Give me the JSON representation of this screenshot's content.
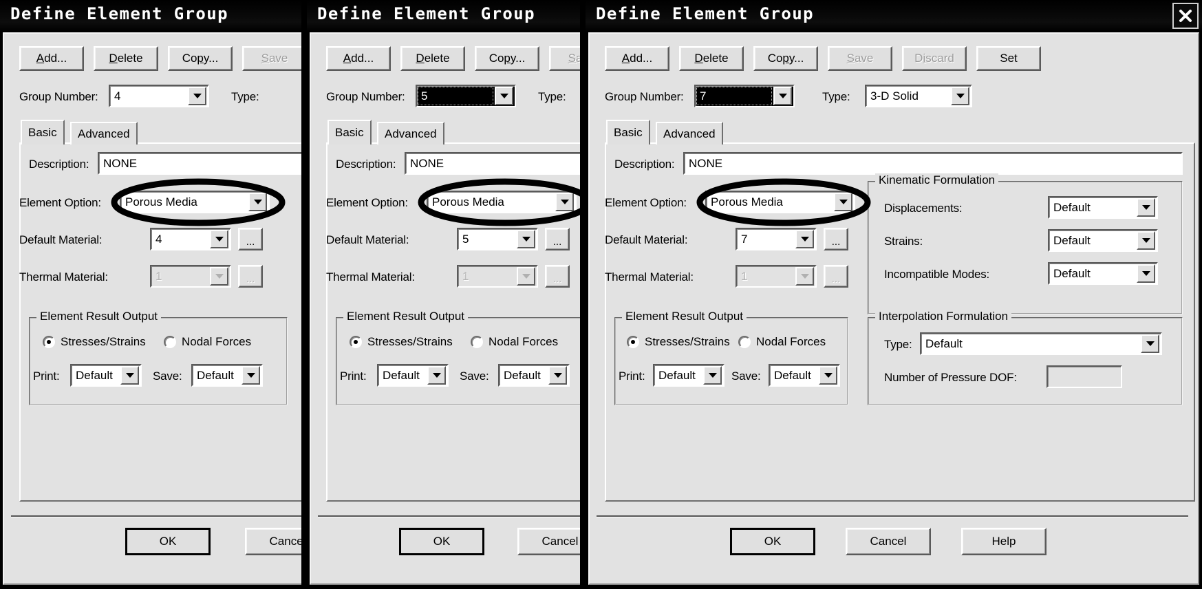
{
  "window": {
    "title": "Define Element Group",
    "close_icon": "close-x-icon"
  },
  "toolbar": {
    "add": "Add...",
    "add_accel": "A",
    "delete": "Delete",
    "delete_accel": "D",
    "copy": "Copy...",
    "copy_accel": "p",
    "save": "Save",
    "save_accel": "S",
    "discard": "Discard",
    "discard_accel": "i",
    "set": "Set"
  },
  "header": {
    "group_number_label": "Group Number:",
    "type_label": "Type:",
    "type_value": "3-D Solid"
  },
  "tabs": [
    {
      "label": "Basic",
      "active": true
    },
    {
      "label": "Advanced",
      "active": false
    }
  ],
  "basic": {
    "description_label": "Description:",
    "description_value": "NONE",
    "element_option_label": "Element Option:",
    "element_option_value": "Porous Media",
    "default_material_label": "Default Material:",
    "browse_label": "...",
    "thermal_material_label": "Thermal Material:",
    "thermal_material_value": "1"
  },
  "element_result_output": {
    "title": "Element Result Output",
    "radio_stresses": "Stresses/Strains",
    "radio_nodal": "Nodal Forces",
    "selected": "Stresses/Strains",
    "print_label": "Print:",
    "print_value": "Default",
    "save_label": "Save:",
    "save_value": "Default"
  },
  "kinematic_formulation": {
    "title": "Kinematic Formulation",
    "displacements_label": "Displacements:",
    "displacements_value": "Default",
    "strains_label": "Strains:",
    "strains_value": "Default",
    "incompatible_label": "Incompatible Modes:",
    "incompatible_value": "Default"
  },
  "interpolation_formulation": {
    "title": "Interpolation Formulation",
    "type_label": "Type:",
    "type_value": "Default",
    "pressure_dof_label": "Number of Pressure DOF:",
    "pressure_dof_value": ""
  },
  "footer": {
    "ok": "OK",
    "cancel": "Cancel",
    "cancel_clipped": "C",
    "help": "Help"
  },
  "panels": {
    "p1": {
      "group_number": "4",
      "default_material": "4",
      "group_selected": false
    },
    "p2": {
      "group_number": "5",
      "default_material": "5",
      "group_selected": true
    },
    "p3": {
      "group_number": "7",
      "default_material": "7",
      "group_selected": true
    }
  },
  "annotation": {
    "shape": "ellipse-highlight",
    "color": "#000000",
    "target": "Element Option combo box"
  }
}
